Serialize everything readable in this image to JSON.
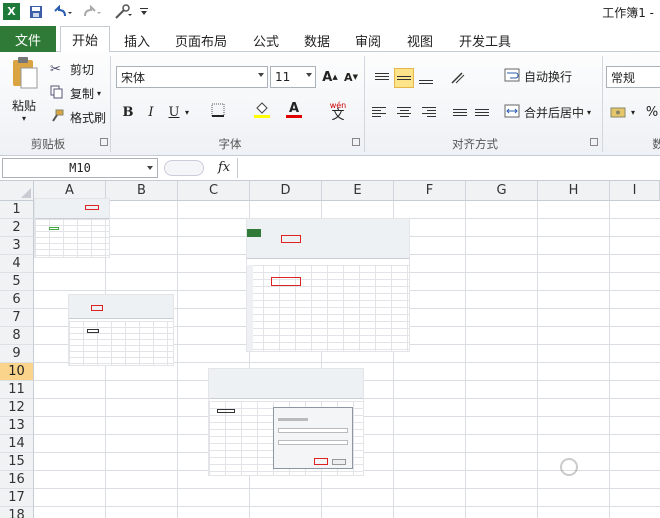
{
  "window": {
    "title": "工作簿1 -"
  },
  "quick_access": [
    "excel-logo-icon",
    "save-icon",
    "undo-icon",
    "redo-icon",
    "tools-icon",
    "customize-icon"
  ],
  "tabs": {
    "file": "文件",
    "items": [
      "开始",
      "插入",
      "页面布局",
      "公式",
      "数据",
      "审阅",
      "视图",
      "开发工具"
    ],
    "active": "开始"
  },
  "ribbon": {
    "clipboard": {
      "paste": "粘贴",
      "cut": "剪切",
      "copy": "复制",
      "format_painter": "格式刷",
      "label": "剪贴板"
    },
    "font": {
      "font_name": "宋体",
      "font_size": "11",
      "grow": "A",
      "shrink": "A",
      "bold": "B",
      "italic": "I",
      "underline": "U",
      "font_color_letter": "A",
      "wen": "wén",
      "wen_char": "文",
      "label": "字体"
    },
    "alignment": {
      "wrap_text": "自动换行",
      "merge_center": "合并后居中",
      "label": "对齐方式"
    },
    "number": {
      "format": "常规",
      "percent": "%",
      "label_partial": "数"
    }
  },
  "formula_bar": {
    "name_box": "M10",
    "fx": "fx",
    "value": ""
  },
  "grid": {
    "columns": [
      "A",
      "B",
      "C",
      "D",
      "E",
      "F",
      "G",
      "H",
      "I"
    ],
    "rows": [
      "1",
      "2",
      "3",
      "4",
      "5",
      "6",
      "7",
      "8",
      "9",
      "10",
      "11",
      "12",
      "13",
      "14",
      "15",
      "16",
      "17",
      "18"
    ],
    "selected_row": "10",
    "colors": {
      "selected_header": "#f9d48a",
      "file_tab": "#2e7a36",
      "highlight_red": "#d22222"
    }
  }
}
